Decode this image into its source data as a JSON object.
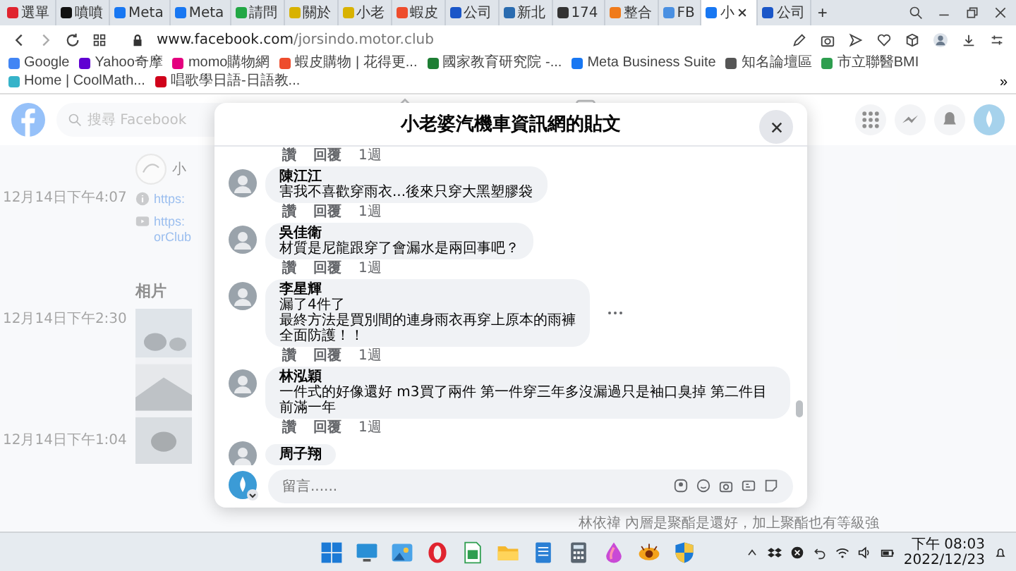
{
  "browser": {
    "tabs": [
      {
        "label": "選單",
        "color": "#e0242f",
        "selected": false
      },
      {
        "label": "噴噴",
        "color": "#111111",
        "selected": false
      },
      {
        "label": "Meta",
        "color": "#1877f2",
        "selected": false
      },
      {
        "label": "Meta",
        "color": "#1877f2",
        "selected": false
      },
      {
        "label": "請問",
        "color": "#22a745",
        "selected": false
      },
      {
        "label": "關於",
        "color": "#d8b200",
        "selected": false
      },
      {
        "label": "小老",
        "color": "#d8b200",
        "selected": false
      },
      {
        "label": "蝦皮",
        "color": "#ee4d2d",
        "selected": false
      },
      {
        "label": "公司",
        "color": "#1a56c8",
        "selected": false
      },
      {
        "label": "新北",
        "color": "#2b6cb0",
        "selected": false
      },
      {
        "label": "174",
        "color": "#333333",
        "selected": false
      },
      {
        "label": "整合",
        "color": "#f07a1a",
        "selected": false
      },
      {
        "label": "FB",
        "color": "#4a90e2",
        "selected": false
      },
      {
        "label": "小",
        "color": "#1877f2",
        "selected": true
      },
      {
        "label": "公司",
        "color": "#1a56c8",
        "selected": false
      }
    ],
    "new_tab": "+",
    "url_host": "www.facebook.com",
    "url_path": "/jorsindo.motor.club",
    "bookmarks": [
      {
        "label": "Google",
        "color": "#4285f4"
      },
      {
        "label": "Yahoo奇摩",
        "color": "#6001d2"
      },
      {
        "label": "momo購物網",
        "color": "#e4007f"
      },
      {
        "label": "蝦皮購物 | 花得更...",
        "color": "#ee4d2d"
      },
      {
        "label": "國家教育研究院 -...",
        "color": "#1e7e34"
      },
      {
        "label": "Meta Business Suite",
        "color": "#1877f2"
      },
      {
        "label": "知名論壇區",
        "color": "#555555"
      },
      {
        "label": "市立聯醫BMI",
        "color": "#2e9e4f"
      },
      {
        "label": "Home | CoolMath...",
        "color": "#36b3c9"
      },
      {
        "label": "唱歌學日語-日語教...",
        "color": "#d0021b"
      }
    ],
    "more_bookmarks": "»"
  },
  "page": {
    "search": {
      "placeholder": "搜尋 Facebook"
    },
    "timestamps": [
      "12月14日下午4:07",
      "12月14日下午2:30",
      "12月14日下午1:04"
    ],
    "page_initial": "小",
    "links": [
      "https:",
      "https:",
      "orClub"
    ],
    "photos_heading": "相片",
    "footer_comment": "林依禕 內層是聚酯是還好，加上聚酯也有等級強"
  },
  "dialog": {
    "title": "小老婆汽機車資訊網的貼文",
    "top_actions": [
      "讚",
      "回覆",
      "1週"
    ],
    "comments": [
      {
        "author": "陳江江",
        "lines": [
          "害我不喜歡穿雨衣...後來只穿大黑塑膠袋"
        ],
        "actions": [
          "讚",
          "回覆",
          "1週"
        ],
        "has_menu": false
      },
      {
        "author": "吳佳衛",
        "lines": [
          "材質是尼龍跟穿了會漏水是兩回事吧？"
        ],
        "actions": [
          "讚",
          "回覆",
          "1週"
        ],
        "has_menu": false
      },
      {
        "author": "李星輝",
        "lines": [
          "漏了4件了",
          "最終方法是買別間的連身雨衣再穿上原本的雨褲",
          "全面防護！！"
        ],
        "actions": [
          "讚",
          "回覆",
          "1週"
        ],
        "has_menu": true
      },
      {
        "author": "林泓穎",
        "lines": [
          "一件式的好像還好 m3買了兩件 第一件穿三年多沒漏過只是袖口臭掉 第二件目前滿一年"
        ],
        "actions": [
          "讚",
          "回覆",
          "1週"
        ],
        "has_menu": false
      },
      {
        "author": "周子翔",
        "has_menu": false
      }
    ],
    "input": {
      "placeholder": "留言......"
    }
  },
  "taskbar": {
    "apps": [
      {
        "kind": "start"
      },
      {
        "kind": "monitor"
      },
      {
        "kind": "photos"
      },
      {
        "kind": "opera"
      },
      {
        "kind": "sheet"
      },
      {
        "kind": "folder"
      },
      {
        "kind": "notes"
      },
      {
        "kind": "calculator"
      },
      {
        "kind": "paint"
      },
      {
        "kind": "eye"
      },
      {
        "kind": "shield"
      }
    ],
    "time": "下午 08:03",
    "date": "2022/12/23"
  }
}
